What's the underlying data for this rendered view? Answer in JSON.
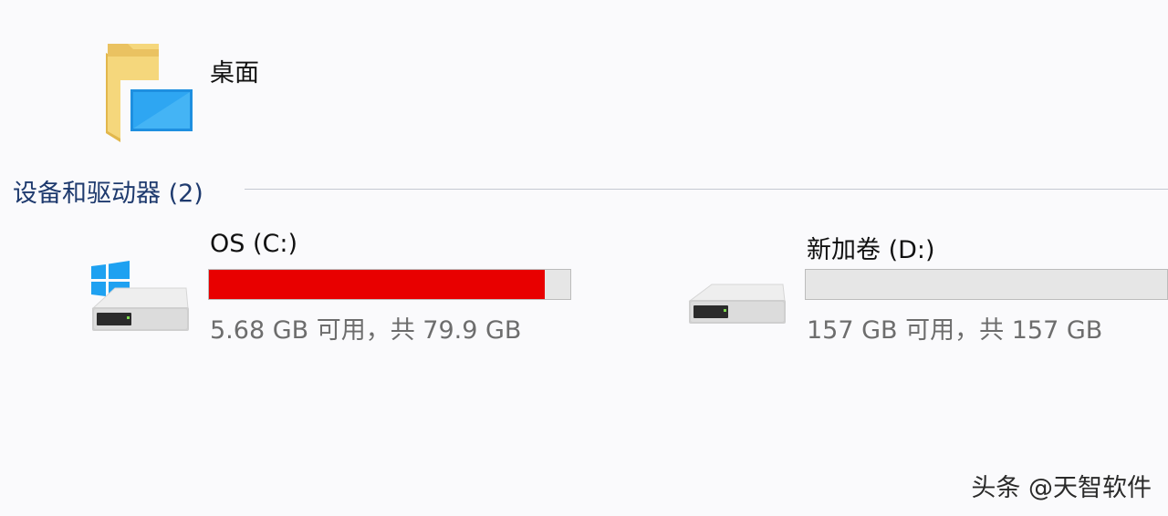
{
  "quick_access": {
    "folder": {
      "label": "桌面",
      "icon": "desktop-folder-icon"
    }
  },
  "devices": {
    "header": "设备和驱动器 (2)",
    "drives": [
      {
        "name": "OS (C:)",
        "space": "5.68 GB 可用，共 79.9 GB",
        "used_fraction": 0.929,
        "bar_color": "#e80000",
        "icon": "windows-system-drive-icon"
      },
      {
        "name": "新加卷 (D:)",
        "space": "157 GB 可用，共 157 GB",
        "used_fraction": 0.0,
        "bar_color": "#26a0da",
        "icon": "hard-drive-icon"
      }
    ]
  },
  "watermark": "头条 @天智软件",
  "colors": {
    "background": "#fafafc",
    "group_header": "#1e3a6e",
    "secondary_text": "#6d6d6d",
    "bar_track": "#e6e6e6",
    "bar_full": "#e80000"
  }
}
